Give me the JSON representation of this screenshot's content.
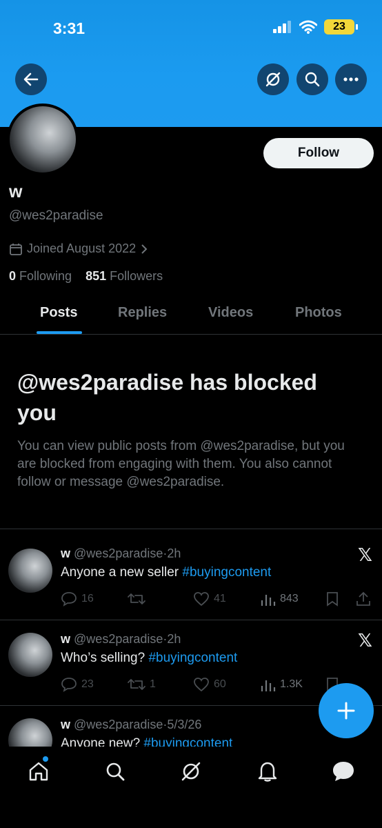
{
  "status_bar": {
    "time": "3:31",
    "battery": "23"
  },
  "header": {
    "back_label": "Back",
    "grok_label": "Grok",
    "search_label": "Search",
    "more_label": "More"
  },
  "profile": {
    "display_name": "w",
    "handle": "@wes2paradise",
    "follow_label": "Follow",
    "joined": "Joined August 2022",
    "following_count": "0",
    "following_label": "Following",
    "followers_count": "851",
    "followers_label": "Followers"
  },
  "tabs": [
    {
      "label": "Posts",
      "active": true
    },
    {
      "label": "Replies",
      "active": false
    },
    {
      "label": "Videos",
      "active": false
    },
    {
      "label": "Photos",
      "active": false
    }
  ],
  "blocked": {
    "title": "@wes2paradise has blocked you",
    "message": "You can view public posts from @wes2paradise, but you are blocked from engaging with them. You also cannot follow or message @wes2paradise."
  },
  "posts": [
    {
      "name": "w",
      "handle": "@wes2paradise",
      "time": "2h",
      "text": "Anyone a new seller ",
      "hashtag": "#buyingcontent",
      "replies": "16",
      "reposts": "",
      "likes": "41",
      "views": "843"
    },
    {
      "name": "w",
      "handle": "@wes2paradise",
      "time": "2h",
      "text": "Who’s selling? ",
      "hashtag": "#buyingcontent",
      "replies": "23",
      "reposts": "1",
      "likes": "60",
      "views": "1.3K"
    },
    {
      "name": "w",
      "handle": "@wes2paradise",
      "time": "5/3/26",
      "text": "Anyone new? ",
      "hashtag": "#buyingcontent",
      "replies": "",
      "reposts": "",
      "likes": "",
      "views": ""
    }
  ],
  "colors": {
    "accent": "#1d9bf0",
    "muted": "#71767b",
    "text": "#e7e9ea"
  }
}
